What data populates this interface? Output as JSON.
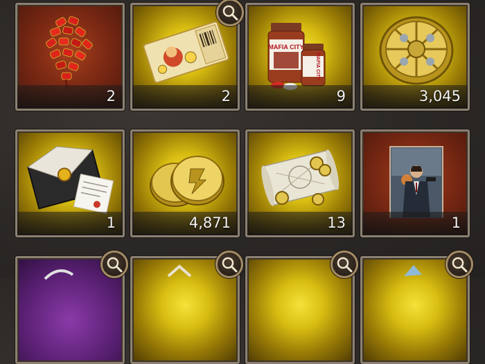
{
  "inventory": {
    "items": [
      {
        "name": "firecrackers",
        "count": "2"
      },
      {
        "name": "ticket",
        "count": "2"
      },
      {
        "name": "supplement-bottles",
        "count": "9"
      },
      {
        "name": "gold-token",
        "count": "3,045"
      },
      {
        "name": "sealed-letter",
        "count": "1"
      },
      {
        "name": "gold-coins",
        "count": "4,871"
      },
      {
        "name": "treasure-map",
        "count": "13"
      },
      {
        "name": "agent-card",
        "count": "1"
      }
    ]
  },
  "bottle_brand": {
    "front": "MAFIA CITY",
    "side": "MAFIA CITY"
  },
  "colors": {
    "slot_gold": "#d9be12",
    "slot_red": "#7d2a14",
    "frame": "#8c8172",
    "count_text": "#f2f2f2"
  },
  "icons": [
    "magnifier-icon"
  ]
}
